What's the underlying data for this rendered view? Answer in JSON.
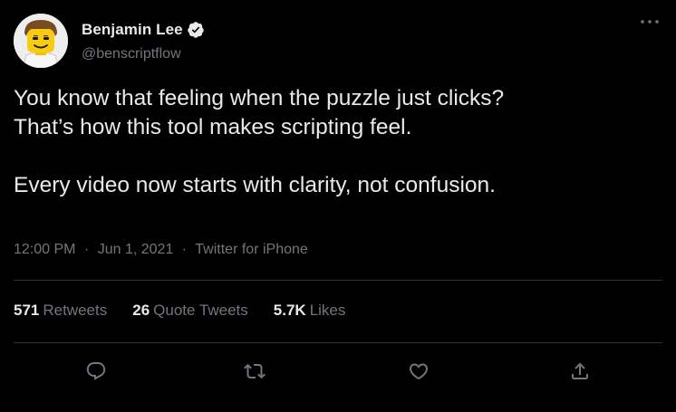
{
  "author": {
    "display_name": "Benjamin Lee",
    "handle": "@benscriptflow",
    "verified": true,
    "avatar_icon": "lego-minifigure-avatar"
  },
  "tweet": {
    "lines": [
      "You know that feeling when the puzzle just clicks?",
      "That’s how this tool makes scripting feel.",
      "Every video now starts with clarity, not confusion."
    ],
    "time": "12:00 PM",
    "date": "Jun 1, 2021",
    "source": "Twitter for iPhone",
    "separator": "·"
  },
  "stats": {
    "retweets": {
      "value": "571",
      "label": "Retweets"
    },
    "quote_tweets": {
      "value": "26",
      "label": "Quote Tweets"
    },
    "likes": {
      "value": "5.7K",
      "label": "Likes"
    }
  },
  "actions": [
    "reply-icon",
    "retweet-icon",
    "like-icon",
    "share-icon"
  ],
  "colors": {
    "background": "#000000",
    "text_primary": "#e7e9ea",
    "text_secondary": "#71767b",
    "divider": "#2f3336",
    "verified_badge": "#e7e9ea"
  }
}
